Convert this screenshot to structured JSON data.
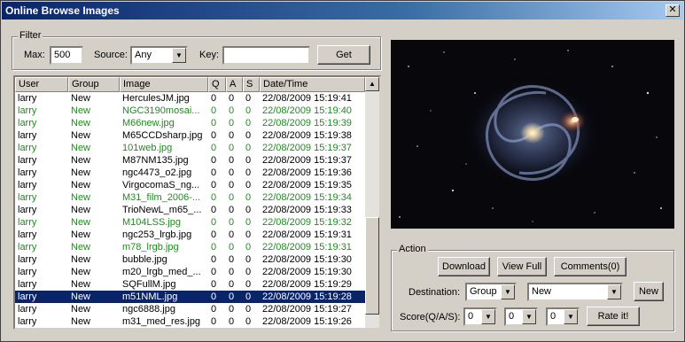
{
  "window": {
    "title": "Online Browse Images",
    "close_glyph": "✕"
  },
  "filter": {
    "legend": "Filter",
    "max_label": "Max:",
    "max_value": "500",
    "source_label": "Source:",
    "source_value": "Any",
    "key_label": "Key:",
    "key_value": "",
    "get_label": "Get"
  },
  "list": {
    "columns": [
      "User",
      "Group",
      "Image",
      "Q",
      "A",
      "S",
      "Date/Time"
    ],
    "rows": [
      {
        "user": "larry",
        "group": "New",
        "image": "HerculesJM.jpg",
        "q": "0",
        "a": "0",
        "s": "0",
        "date": "22/08/2009 15:19:41",
        "color": "black"
      },
      {
        "user": "larry",
        "group": "New",
        "image": "NGC3190mosai...",
        "q": "0",
        "a": "0",
        "s": "0",
        "date": "22/08/2009 15:19:40",
        "color": "green"
      },
      {
        "user": "larry",
        "group": "New",
        "image": "M66new.jpg",
        "q": "0",
        "a": "0",
        "s": "0",
        "date": "22/08/2009 15:19:39",
        "color": "green"
      },
      {
        "user": "larry",
        "group": "New",
        "image": "M65CCDsharp.jpg",
        "q": "0",
        "a": "0",
        "s": "0",
        "date": "22/08/2009 15:19:38",
        "color": "black"
      },
      {
        "user": "larry",
        "group": "New",
        "image": "101web.jpg",
        "q": "0",
        "a": "0",
        "s": "0",
        "date": "22/08/2009 15:19:37",
        "color": "green"
      },
      {
        "user": "larry",
        "group": "New",
        "image": "M87NM135.jpg",
        "q": "0",
        "a": "0",
        "s": "0",
        "date": "22/08/2009 15:19:37",
        "color": "black"
      },
      {
        "user": "larry",
        "group": "New",
        "image": "ngc4473_o2.jpg",
        "q": "0",
        "a": "0",
        "s": "0",
        "date": "22/08/2009 15:19:36",
        "color": "black"
      },
      {
        "user": "larry",
        "group": "New",
        "image": "VirgocomaS_ng...",
        "q": "0",
        "a": "0",
        "s": "0",
        "date": "22/08/2009 15:19:35",
        "color": "black"
      },
      {
        "user": "larry",
        "group": "New",
        "image": "M31_film_2006-...",
        "q": "0",
        "a": "0",
        "s": "0",
        "date": "22/08/2009 15:19:34",
        "color": "green"
      },
      {
        "user": "larry",
        "group": "New",
        "image": "TrioNewL_m65_...",
        "q": "0",
        "a": "0",
        "s": "0",
        "date": "22/08/2009 15:19:33",
        "color": "black"
      },
      {
        "user": "larry",
        "group": "New",
        "image": "M104LSS.jpg",
        "q": "0",
        "a": "0",
        "s": "0",
        "date": "22/08/2009 15:19:32",
        "color": "green"
      },
      {
        "user": "larry",
        "group": "New",
        "image": "ngc253_lrgb.jpg",
        "q": "0",
        "a": "0",
        "s": "0",
        "date": "22/08/2009 15:19:31",
        "color": "black"
      },
      {
        "user": "larry",
        "group": "New",
        "image": "m78_lrgb.jpg",
        "q": "0",
        "a": "0",
        "s": "0",
        "date": "22/08/2009 15:19:31",
        "color": "green"
      },
      {
        "user": "larry",
        "group": "New",
        "image": "bubble.jpg",
        "q": "0",
        "a": "0",
        "s": "0",
        "date": "22/08/2009 15:19:30",
        "color": "black"
      },
      {
        "user": "larry",
        "group": "New",
        "image": "m20_lrgb_med_...",
        "q": "0",
        "a": "0",
        "s": "0",
        "date": "22/08/2009 15:19:30",
        "color": "black"
      },
      {
        "user": "larry",
        "group": "New",
        "image": "SQFullM.jpg",
        "q": "0",
        "a": "0",
        "s": "0",
        "date": "22/08/2009 15:19:29",
        "color": "black"
      },
      {
        "user": "larry",
        "group": "New",
        "image": "m51NML.jpg",
        "q": "0",
        "a": "0",
        "s": "0",
        "date": "22/08/2009 15:19:28",
        "color": "selected"
      },
      {
        "user": "larry",
        "group": "New",
        "image": "ngc6888.jpg",
        "q": "0",
        "a": "0",
        "s": "0",
        "date": "22/08/2009 15:19:27",
        "color": "black"
      },
      {
        "user": "larry",
        "group": "New",
        "image": "m31_med_res.jpg",
        "q": "0",
        "a": "0",
        "s": "0",
        "date": "22/08/2009 15:19:26",
        "color": "black"
      }
    ]
  },
  "action": {
    "legend": "Action",
    "download_label": "Download",
    "view_full_label": "View Full",
    "comments_label": "Comments(0)",
    "destination_label": "Destination:",
    "destination_group": "Group",
    "destination_name": "New",
    "new_label": "New",
    "score_label": "Score(Q/A/S):",
    "score_q": "0",
    "score_a": "0",
    "score_s": "0",
    "rate_label": "Rate it!"
  },
  "colors": {
    "title_bar": "#0a246a",
    "green_row": "#1e8c1e",
    "selection": "#0a246a"
  }
}
